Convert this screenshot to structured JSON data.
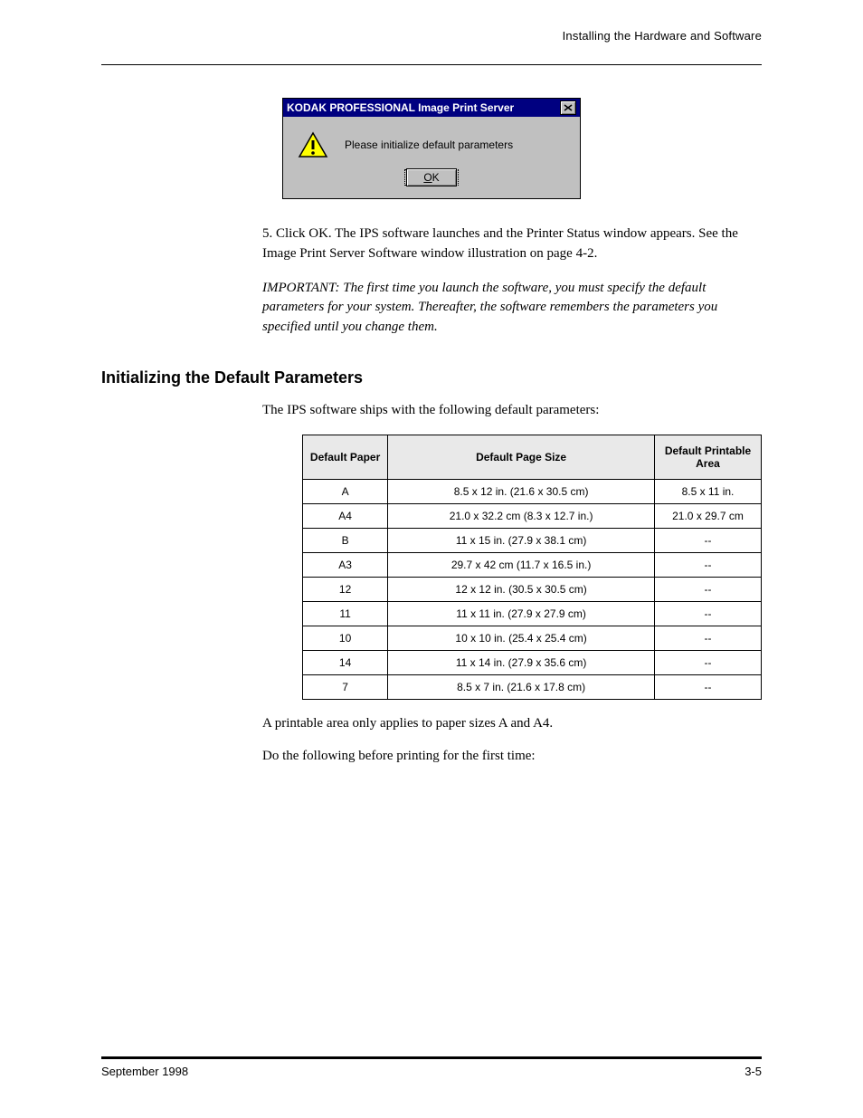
{
  "running_head": "Installing the Hardware and Software",
  "dialog": {
    "title": "KODAK PROFESSIONAL Image Print Server",
    "message": "Please initialize default parameters",
    "ok_label": "OK"
  },
  "step5": {
    "num": "5.",
    "text": "Click OK. The IPS software launches and the Printer Status window appears. See the Image Print Server Software window illustration on page 4-2."
  },
  "important": "IMPORTANT: The first time you launch the software, you must specify the default parameters for your system. Thereafter, the software remembers the parameters you specified until you change them.",
  "section": {
    "title": "Initializing the Default Parameters",
    "lead": "The IPS software ships with the following default parameters:"
  },
  "table": {
    "headers": [
      "Default Paper",
      "Default Page Size",
      "Default Printable Area"
    ],
    "rows": [
      [
        "A",
        "8.5 x 12 in. (21.6 x 30.5 cm)",
        "8.5 x 11 in."
      ],
      [
        "A4",
        "21.0 x 32.2 cm (8.3 x 12.7 in.)",
        "21.0 x 29.7 cm"
      ],
      [
        "B",
        "11 x 15 in. (27.9 x 38.1 cm)",
        "--"
      ],
      [
        "A3",
        "29.7 x 42 cm (11.7 x 16.5 in.)",
        "--"
      ],
      [
        "12",
        "12 x 12 in. (30.5 x 30.5 cm)",
        "--"
      ],
      [
        "11",
        "11 x 11 in. (27.9 x 27.9 cm)",
        "--"
      ],
      [
        "10",
        "10 x 10 in. (25.4 x 25.4 cm)",
        "--"
      ],
      [
        "14",
        "11 x 14 in. (27.9 x 35.6 cm)",
        "--"
      ],
      [
        "7",
        "8.5 x 7 in. (21.6 x 17.8 cm)",
        "--"
      ]
    ]
  },
  "below_table": [
    "A printable area only applies to paper sizes A and A4.",
    "Do the following before printing for the first time:"
  ],
  "footer": {
    "left": "September 1998",
    "right": "3-5"
  }
}
